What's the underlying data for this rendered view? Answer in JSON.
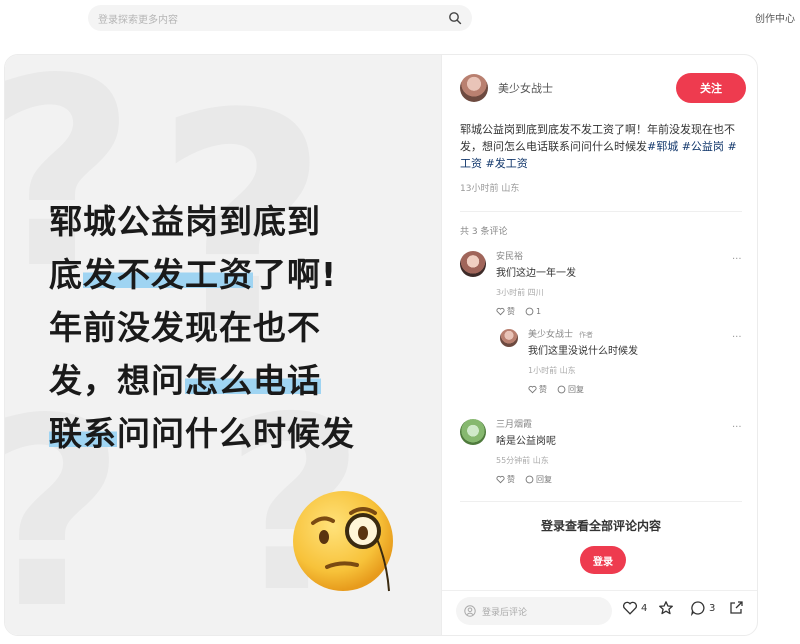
{
  "header": {
    "search_placeholder": "登录探索更多内容",
    "creator_center": "创作中心"
  },
  "image": {
    "lines": [
      {
        "pre": "郓城公益岗到底到",
        "hl": "",
        "post": ""
      },
      {
        "pre": "底",
        "hl": "发不发工资",
        "post": "了啊!"
      },
      {
        "pre": "年前没发现在也不",
        "hl": "",
        "post": ""
      },
      {
        "pre": "发，想问",
        "hl": "怎么电话",
        "post": ""
      },
      {
        "pre": "",
        "hl": "联系",
        "post": "问问什么时候发"
      }
    ]
  },
  "post": {
    "author": "美少女战士",
    "follow_label": "关注",
    "text": "郓城公益岗到底到底发不发工资了啊！年前没发现在也不发，想问怎么电话联系问问什么时候发",
    "tags": [
      "#郓城",
      "#公益岗",
      "#工资",
      "#发工资"
    ],
    "meta": "13小时前 山东"
  },
  "comments": {
    "count_label": "共 3 条评论",
    "items": [
      {
        "name": "安民裕",
        "text": "我们这边一年一发",
        "meta": "3小时前 四川",
        "likes": "赞",
        "replies": "1"
      },
      {
        "name": "美少女战士",
        "badge": "作者",
        "text": "我们这里没说什么时候发",
        "meta": "1小时前 山东",
        "likes": "赞",
        "replies": "回复"
      },
      {
        "name": "三月烟霞",
        "text": "啥是公益岗呢",
        "meta": "55分钟前 山东",
        "likes": "赞",
        "replies": "回复"
      }
    ],
    "more_icon": "..."
  },
  "login": {
    "prompt": "登录查看全部评论内容",
    "button": "登录"
  },
  "bottom_bar": {
    "input_placeholder": "登录后评论",
    "likes": "4",
    "comments": "3"
  },
  "colors": {
    "accent": "#ee3b4f",
    "tag": "#13386c",
    "highlight": "#9fd4f2"
  }
}
